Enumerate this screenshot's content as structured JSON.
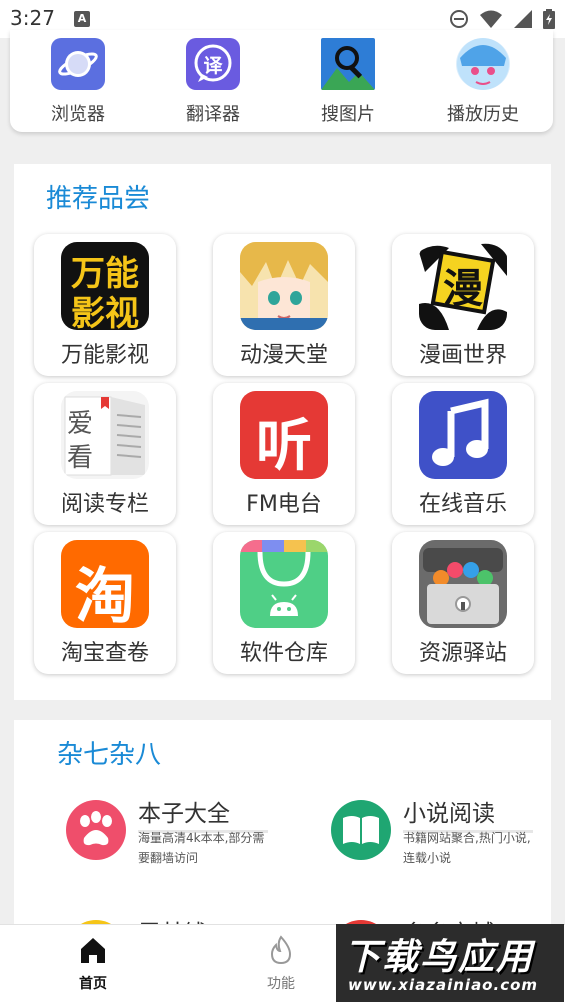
{
  "status_bar": {
    "time": "3:27",
    "notification_letter": "A"
  },
  "tools": [
    {
      "label": "浏览器",
      "icon": "browser-icon"
    },
    {
      "label": "翻译器",
      "icon": "translate-icon",
      "glyph": "译"
    },
    {
      "label": "搜图片",
      "icon": "image-search-icon"
    },
    {
      "label": "播放历史",
      "icon": "anime-avatar-icon"
    }
  ],
  "recommend": {
    "title": "推荐品尝",
    "apps": [
      {
        "label": "万能影视",
        "icon": "wanneng-yingshi-icon",
        "icon_text": [
          "万能",
          "影视"
        ]
      },
      {
        "label": "动漫天堂",
        "icon": "anime-character-icon"
      },
      {
        "label": "漫画世界",
        "icon": "manga-logo-icon",
        "icon_text": [
          "漫"
        ]
      },
      {
        "label": "阅读专栏",
        "icon": "book-reading-icon",
        "icon_text": [
          "爱",
          "看"
        ]
      },
      {
        "label": "FM电台",
        "icon": "fm-radio-icon",
        "icon_text": [
          "听"
        ]
      },
      {
        "label": "在线音乐",
        "icon": "music-note-icon"
      },
      {
        "label": "淘宝查卷",
        "icon": "taobao-icon",
        "icon_text": [
          "淘"
        ]
      },
      {
        "label": "软件仓库",
        "icon": "app-store-bag-icon"
      },
      {
        "label": "资源驿站",
        "icon": "resource-box-icon"
      }
    ]
  },
  "misc": {
    "title": "杂七杂八",
    "items": [
      {
        "title": "本子大全",
        "desc": "海量高清4k本本,部分需要翻墙访问",
        "icon": "paw-icon",
        "color": "#ef4e6b"
      },
      {
        "title": "小说阅读",
        "desc": "书籍网站聚合,热门小说,连载小说",
        "icon": "open-book-icon",
        "color": "#1fa672"
      },
      {
        "title": "震某钱",
        "icon": "yellow-circle-icon",
        "color": "#f5c518"
      },
      {
        "title": "多多商城",
        "icon": "red-circle-icon",
        "color": "#e53935"
      }
    ]
  },
  "bottom_nav": [
    {
      "label": "首页",
      "icon": "home-icon",
      "active": true
    },
    {
      "label": "功能",
      "icon": "flame-icon",
      "active": false
    }
  ],
  "watermark": {
    "main": "下载鸟应用",
    "url": "www.xiazainiao.com"
  },
  "colors": {
    "accent": "#1a8ad6",
    "panel_bg": "#ffffff",
    "page_bg": "#efefef"
  }
}
